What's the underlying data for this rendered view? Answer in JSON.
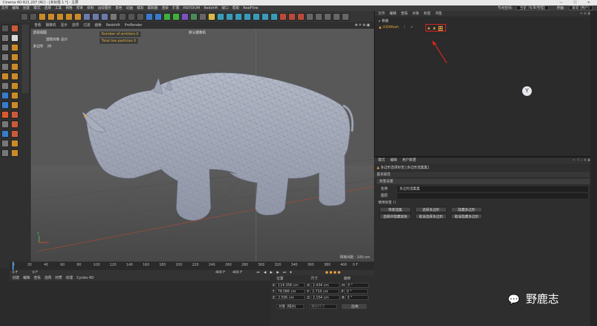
{
  "window": {
    "title": "Cinema 4D R21.207 (RC) - [未标题 1 *] - 主要"
  },
  "menubar": {
    "items": [
      "文件",
      "编辑",
      "创建",
      "模式",
      "选择",
      "工具",
      "网格",
      "样条",
      "体积",
      "运动图形",
      "角色",
      "动画",
      "模拟",
      "跟踪器",
      "渲染",
      "扩展",
      "INSYDIUM",
      "Redshift",
      "窗口",
      "帮助",
      "RealFlow"
    ],
    "node_space_label": "节点空间:",
    "node_space_value": "当前 (标准/物理)",
    "layout_label": "界面:",
    "layout_value": "启动 (用户)"
  },
  "viewport": {
    "menu": [
      "查看",
      "摄像机",
      "显示",
      "选项",
      "过滤",
      "面板",
      "Redshift",
      "ProRender"
    ],
    "view_name": "透视视图",
    "camera_label": "默认摄像机",
    "selected_total": "选取对象 总计",
    "polygon_label": "多边形",
    "polygon_count": "26",
    "emitters": "Number of emitters 0",
    "particles": "Total live particles 0",
    "grid_spacing": "网格间距 : 100 cm"
  },
  "timeline": {
    "ticks": [
      "0",
      "20",
      "40",
      "60",
      "80",
      "100",
      "120",
      "140",
      "160",
      "180",
      "200",
      "220",
      "240",
      "260",
      "280",
      "300",
      "320",
      "340",
      "360",
      "380",
      "400"
    ],
    "current_frame": "0 F",
    "start_frame": "0 F",
    "end_frame": "400 F",
    "end_frame2": "400 F",
    "frame_display": "0 F"
  },
  "material_tabs": [
    "创建",
    "编辑",
    "查看",
    "选择",
    "材质",
    "纹理",
    "Cycles 4D"
  ],
  "coordinates": {
    "headers": {
      "position": "位置",
      "size": "尺寸",
      "rotation": "旋转"
    },
    "rows": [
      {
        "axis": "X",
        "pos": "114.356 cm",
        "size_axis": "X",
        "size": "2.434 cm",
        "rot_axis": "H",
        "rot": "0 °"
      },
      {
        "axis": "Y",
        "pos": "78.086 cm",
        "size_axis": "Y",
        "size": "2.716 cm",
        "rot_axis": "P",
        "rot": "0 °"
      },
      {
        "axis": "Z",
        "pos": "2.595 cm",
        "size_axis": "Z",
        "size": "2.154 cm",
        "rot_axis": "B",
        "rot": "0 °"
      }
    ],
    "mode_value": "对象 (相对)",
    "size_mode": "绝对尺寸",
    "apply_label": "应用"
  },
  "object_manager": {
    "menu": [
      "文件",
      "编辑",
      "查看",
      "对象",
      "标签",
      "书签"
    ],
    "objects": [
      {
        "name": "骨骼",
        "color": "#cfcfcf"
      },
      {
        "name": "U3DMesh",
        "color": "#e8a23a"
      }
    ]
  },
  "attributes": {
    "menu": [
      "模式",
      "编辑",
      "用户数据"
    ],
    "header": "多边形选择标签 [多边形选集集]",
    "tab": "基本属性",
    "section": "标签设置",
    "name_label": "名称",
    "name_value": "多边形选集集",
    "layer_label": "图层",
    "use_selection": "使用标签 ☐",
    "buttons": [
      "恢复选集",
      "选择多边形",
      "隐藏多边形",
      "选择并隐藏其他",
      "取消选择多边形",
      "取消隐藏多边形"
    ]
  },
  "watermark": {
    "text": "野鹿志"
  },
  "colors": {
    "accent": "#e8a23a",
    "annotation": "#e0261e",
    "viewport_bg": "#5a5a5a"
  }
}
